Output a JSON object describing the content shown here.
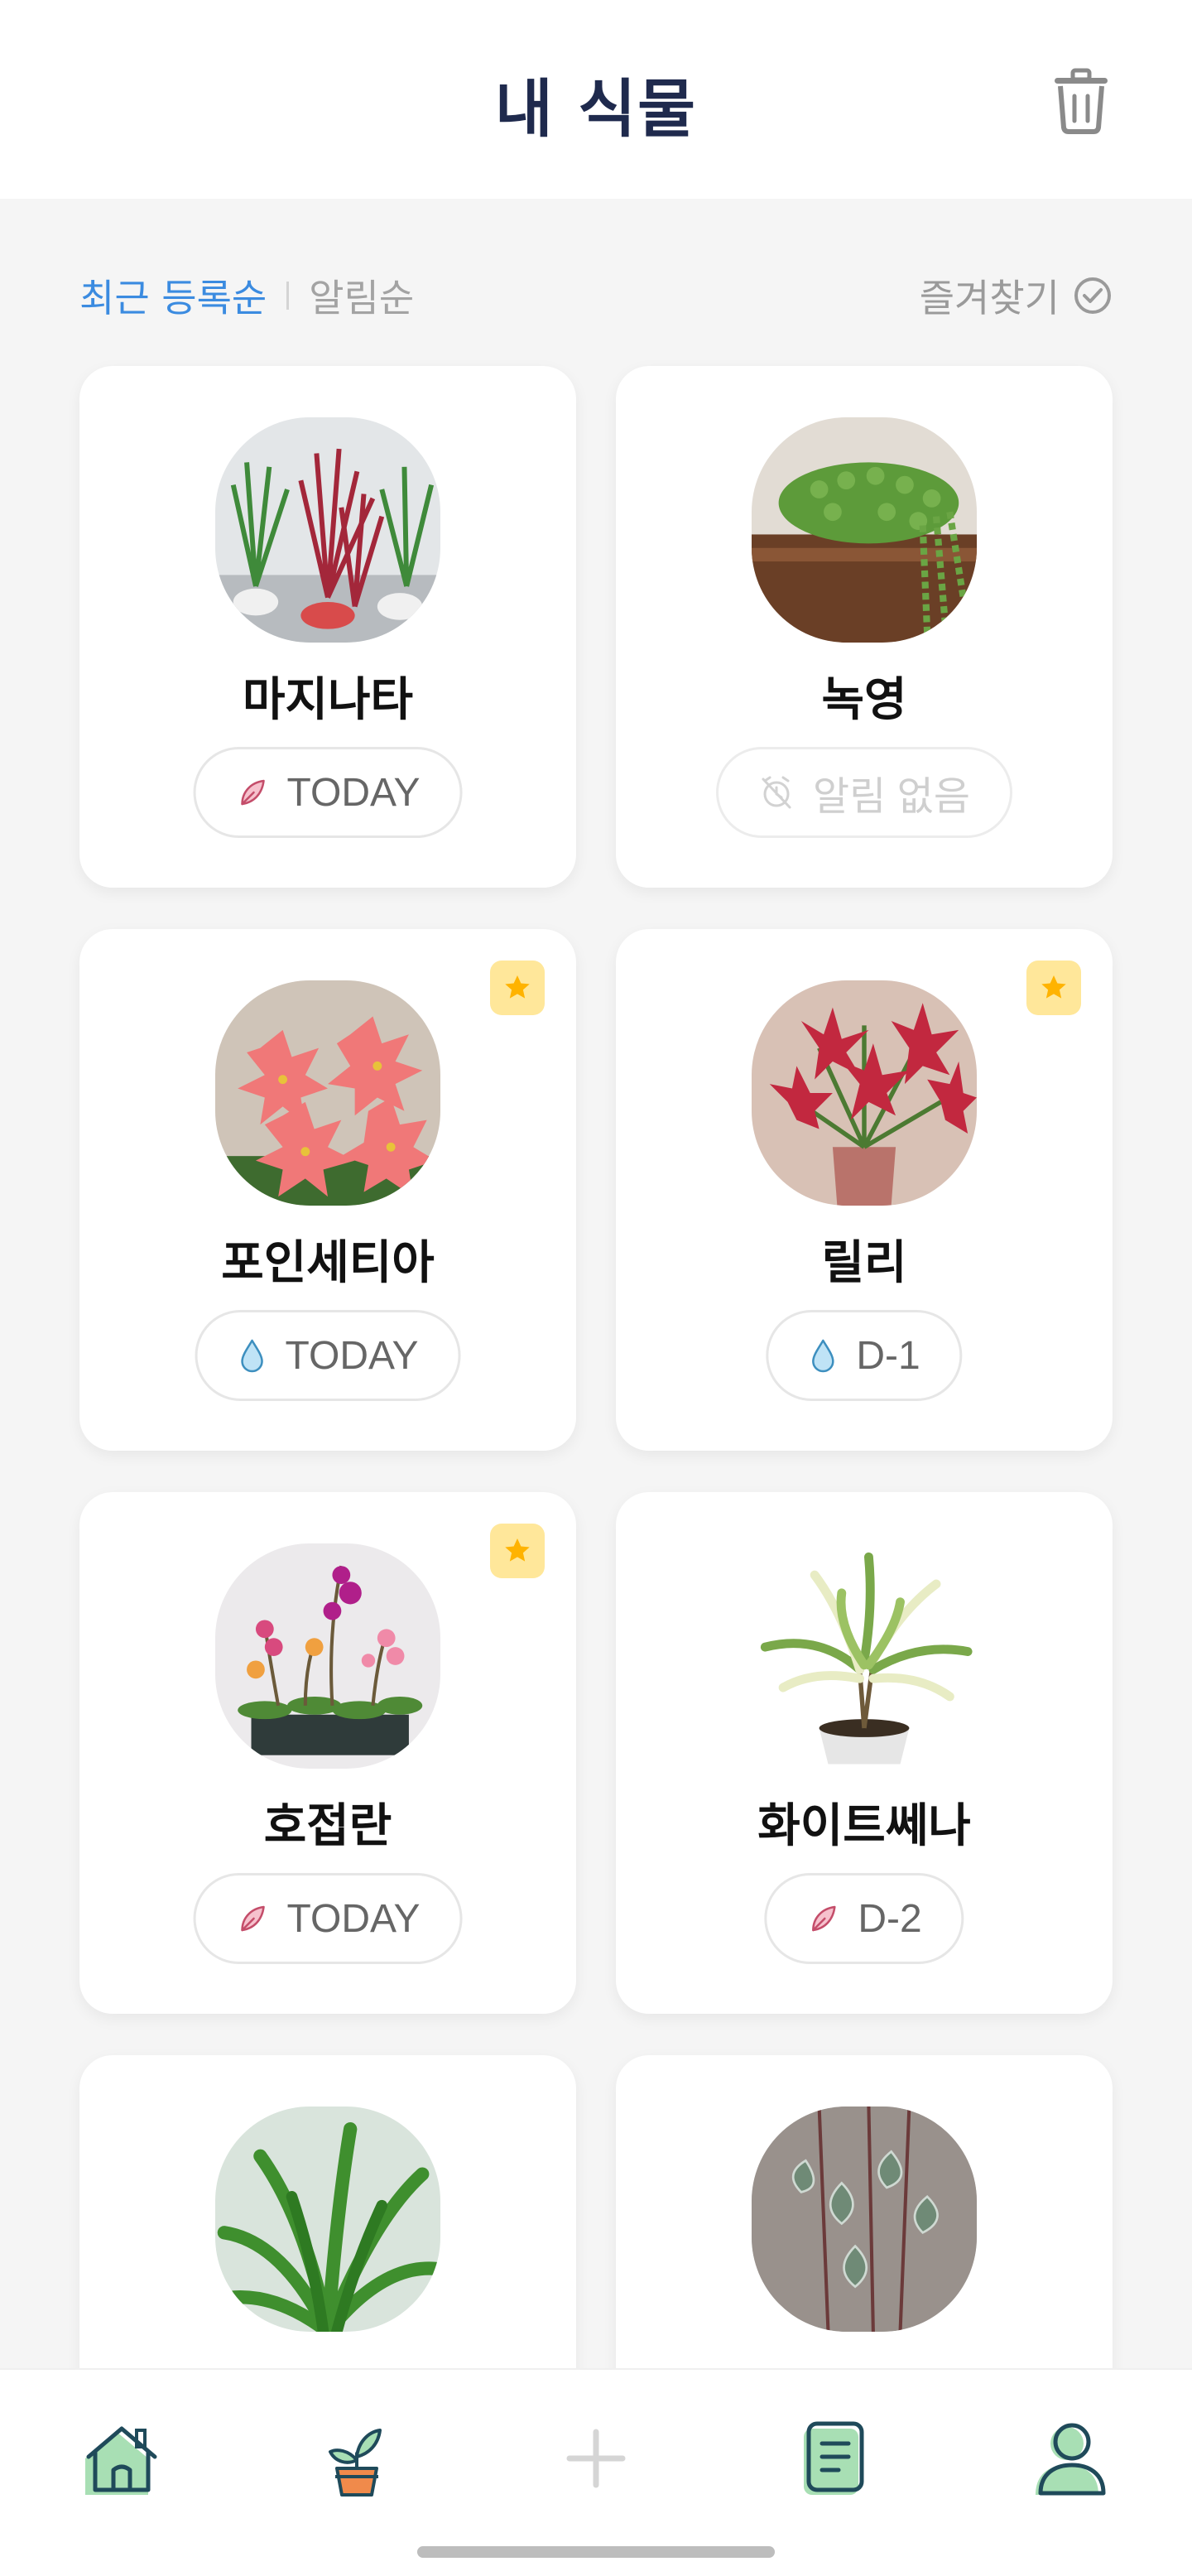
{
  "header": {
    "title": "내 식물",
    "trash_icon": "trash-icon"
  },
  "filters": {
    "sort_recent": "최근 등록순",
    "sort_alert": "알림순",
    "favorites": "즐겨찾기",
    "favorites_icon": "check-circle-icon"
  },
  "colors": {
    "accent": "#3b8be0",
    "title": "#1f2a4d",
    "star_bg": "#ffe79a",
    "star": "#ffb300",
    "nav_green": "#a8dfb4",
    "nav_outline": "#1f4a5a"
  },
  "plants": [
    {
      "name": "마지나타",
      "status": "TODAY",
      "status_icon": "fertilizer-icon",
      "favorite": false
    },
    {
      "name": "녹영",
      "status": "알림 없음",
      "status_icon": "alarm-off-icon",
      "favorite": false
    },
    {
      "name": "포인세티아",
      "status": "TODAY",
      "status_icon": "water-drop-icon",
      "favorite": true
    },
    {
      "name": "릴리",
      "status": "D-1",
      "status_icon": "water-drop-icon",
      "favorite": true
    },
    {
      "name": "호접란",
      "status": "TODAY",
      "status_icon": "fertilizer-icon",
      "favorite": true
    },
    {
      "name": "화이트쎄나",
      "status": "D-2",
      "status_icon": "fertilizer-icon",
      "favorite": false
    },
    {
      "name": "",
      "status": "",
      "status_icon": "",
      "favorite": false
    },
    {
      "name": "",
      "status": "",
      "status_icon": "",
      "favorite": false
    }
  ],
  "nav": [
    {
      "icon": "home-icon"
    },
    {
      "icon": "potted-plant-icon"
    },
    {
      "icon": "plus-icon"
    },
    {
      "icon": "notebook-icon"
    },
    {
      "icon": "profile-icon"
    }
  ]
}
